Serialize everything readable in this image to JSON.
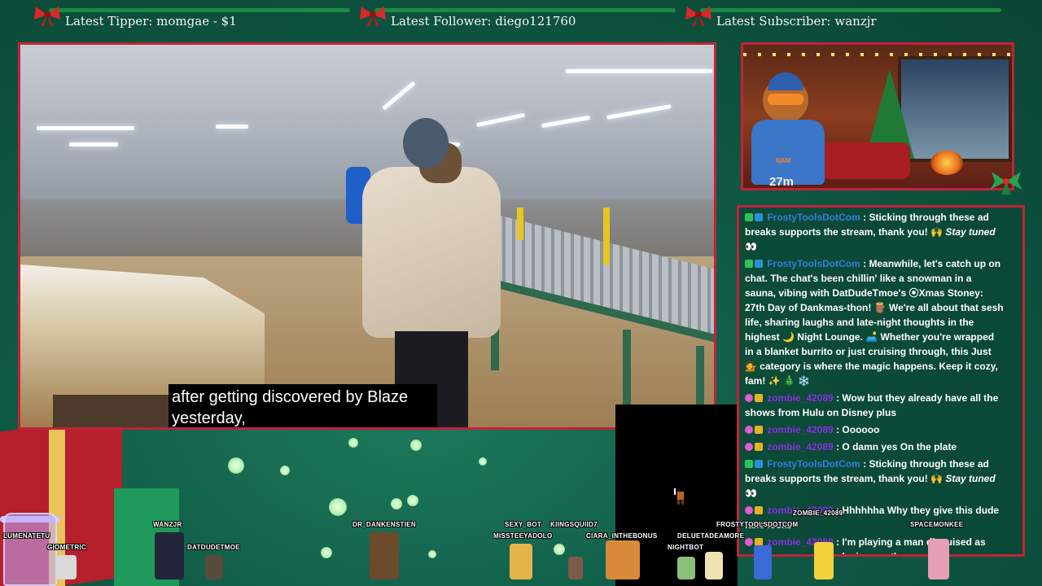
{
  "topbar": {
    "tipper": "Latest Tipper: momgae - $1",
    "follower": "Latest Follower: diego121760",
    "subscriber": "Latest Subscriber: wanzjr"
  },
  "video": {
    "subtitle_line1": "after getting discovered by Blaze",
    "subtitle_line2": "yesterday,"
  },
  "webcam": {
    "jersey_number": "27m",
    "jersey_tag": "NAM"
  },
  "chat": {
    "messages": [
      {
        "user": "FrostyToolsDotCom",
        "text": ": Sticking through these ad breaks supports the stream, thank you! 🙌 ",
        "extra": "Stay tuned",
        "tail": " 👀"
      },
      {
        "user": "FrostyToolsDotCom",
        "text": ": Meanwhile, let's catch up on chat. The chat's been chillin' like a snowman in a sauna, vibing with DatDudeTmoe's ⦿Xmas Stoney: 27th Day of Dankmas-thon! 🪵 We're all about that sesh life, sharing laughs and late-night thoughts in the highest 🌙 Night Lounge. 🛋️ Whether you're wrapped in a blanket burrito or just cruising through, this Just 💁 category is where the magic happens. Keep it cozy, fam! ✨ 🎄 ❄️"
      },
      {
        "user": "zombie_42089",
        "text": ": Wow but they already have all the shows from Hulu on Disney plus"
      },
      {
        "user": "zombie_42089",
        "text": ": Oooooo"
      },
      {
        "user": "zombie_42089",
        "text": ": O damn yes On the plate"
      },
      {
        "user": "FrostyToolsDotCom",
        "text": ": Sticking through these ad breaks supports the stream, thank you! 🙌 ",
        "extra": "Stay tuned",
        "tail": " 👀"
      },
      {
        "user": "zombie_42089",
        "text": ": Hhhhhha Why they give this dude fake locks"
      },
      {
        "user": "zombie_42089",
        "text": ": I'm playing a man disguised as another man who's playing another man."
      }
    ]
  },
  "avatars": {
    "lumenatetu": "LUMENATETU",
    "giometric": "GIOMETRIC",
    "wanzjr": "WANZJR",
    "datdudetmoe": "DATDUDETMOE",
    "dr_dankenstien": "DR_DANKENSTIEN",
    "sexy_bot": "SEXY_BOT",
    "missteeyadolo": "MISSTEEYADOLO",
    "kiingsquiid7": "KIINGSQUIID7",
    "ciara_inthebonus": "CIARA_INTHEBONUS",
    "nightbot": "NIGHTBOT",
    "frostytoolsdotcom": "FROSTYTOOLSDOTCOM",
    "deluetadeamore": "DELUETADEAMORE",
    "zombie_42089": "ZOMBIE_42089",
    "spacemonkee": "SPACEMONKEE"
  },
  "colors": {
    "frame_red": "#c4213a",
    "bg_green": "#0f5a45",
    "chat_user_blue": "#2f7fe0",
    "chat_user_purple": "#8a2fe0"
  }
}
